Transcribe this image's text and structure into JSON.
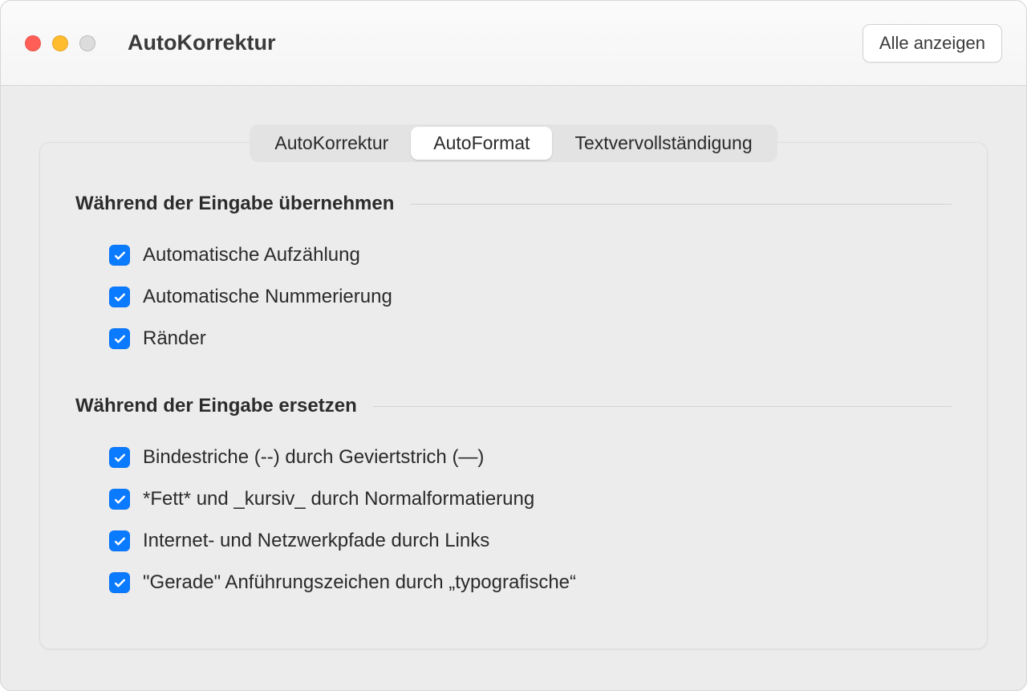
{
  "header": {
    "title": "AutoKorrektur",
    "show_all": "Alle anzeigen"
  },
  "tabs": [
    {
      "label": "AutoKorrektur",
      "active": false
    },
    {
      "label": "AutoFormat",
      "active": true
    },
    {
      "label": "Textvervollständigung",
      "active": false
    }
  ],
  "sections": {
    "apply": {
      "title": "Während der Eingabe übernehmen",
      "items": [
        {
          "label": "Automatische Aufzählung",
          "checked": true
        },
        {
          "label": "Automatische Nummerierung",
          "checked": true
        },
        {
          "label": "Ränder",
          "checked": true
        }
      ]
    },
    "replace": {
      "title": "Während der Eingabe ersetzen",
      "items": [
        {
          "label": "Bindestriche (--) durch Geviertstrich (—)",
          "checked": true
        },
        {
          "label": "*Fett* und _kursiv_ durch Normalformatierung",
          "checked": true
        },
        {
          "label": "Internet- und Netzwerkpfade durch Links",
          "checked": true
        },
        {
          "label": "\"Gerade\" Anführungszeichen durch „typografische“",
          "checked": true
        }
      ]
    }
  }
}
